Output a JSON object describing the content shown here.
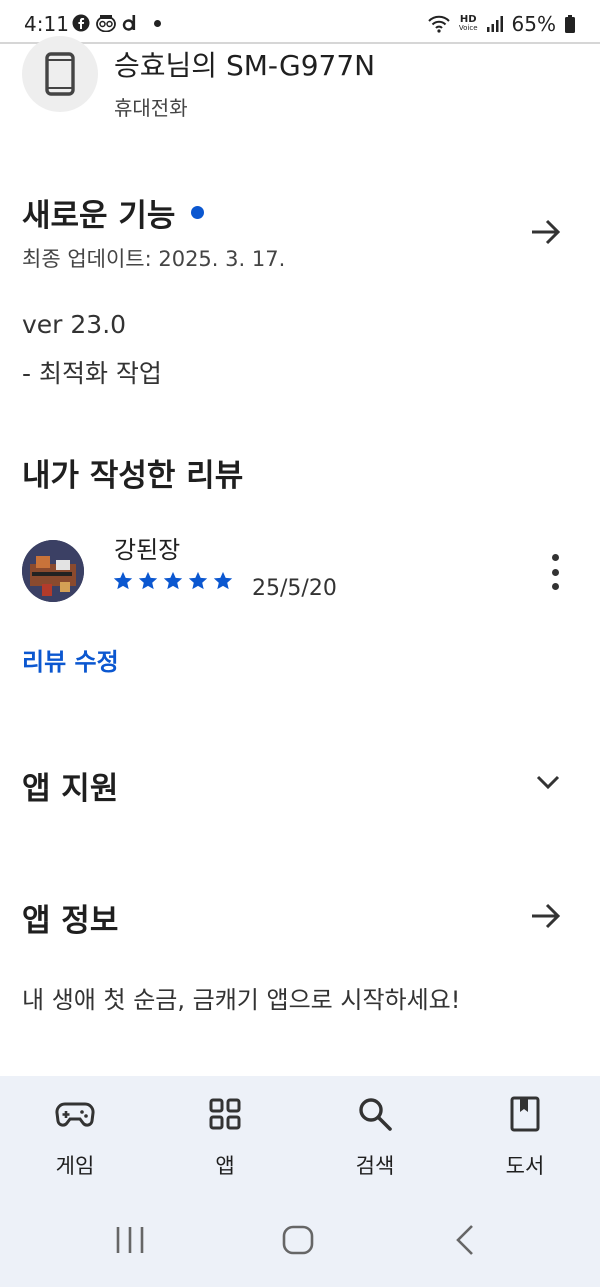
{
  "status_bar": {
    "time": "4:11",
    "battery": "65%",
    "hd_label": "HD",
    "voice_label": "Voice"
  },
  "device": {
    "name": "승효님의 SM-G977N",
    "type": "휴대전화",
    "icon": "phone-icon"
  },
  "whats_new": {
    "title": "새로운 기능",
    "updated": "최종 업데이트: 2025. 3. 17.",
    "version": "ver 23.0",
    "note": "- 최적화 작업",
    "dot_color": "#0b57d0"
  },
  "my_review": {
    "title": "내가 작성한 리뷰",
    "reviewer": "강된장",
    "rating": 5,
    "max_rating": 5,
    "date": "25/5/20",
    "edit_label": "리뷰 수정",
    "star_color": "#0b57d0"
  },
  "app_support": {
    "title": "앱 지원"
  },
  "app_info": {
    "title": "앱 정보",
    "description": "내 생애 첫 순금, 금캐기 앱으로 시작하세요!"
  },
  "bottom_nav": {
    "items": [
      {
        "label": "게임",
        "icon": "gamepad-icon"
      },
      {
        "label": "앱",
        "icon": "apps-grid-icon"
      },
      {
        "label": "검색",
        "icon": "search-icon"
      },
      {
        "label": "도서",
        "icon": "book-icon"
      }
    ]
  },
  "system_nav": {
    "items": [
      "recents-icon",
      "home-icon",
      "back-icon"
    ]
  }
}
